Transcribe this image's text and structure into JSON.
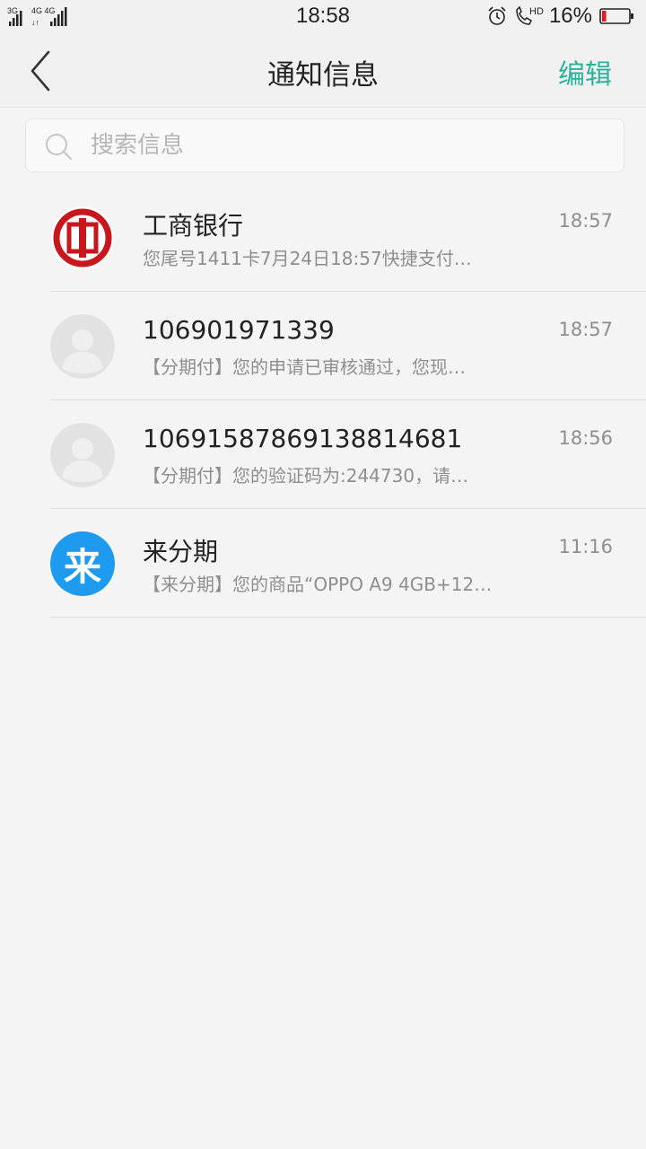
{
  "status_bar": {
    "network_left": "3G",
    "network_right": "4G 4G",
    "time": "18:58",
    "hd": "HD",
    "battery_percent": "16%",
    "battery_level": 0.16
  },
  "header": {
    "title": "通知信息",
    "edit_label": "编辑"
  },
  "search": {
    "placeholder": "搜索信息"
  },
  "colors": {
    "accent": "#2bb39a",
    "icbc_red": "#c8161d",
    "lai_blue": "#1e9bef",
    "battery_red": "#e02020"
  },
  "conversations": [
    {
      "name": "工商银行",
      "preview": "您尾号1411卡7月24日18:57快捷支付…",
      "time": "18:57",
      "avatar": "icbc-logo"
    },
    {
      "name": "106901971339",
      "preview": "【分期付】您的申请已审核通过，您现…",
      "time": "18:57",
      "avatar": "default-person-icon"
    },
    {
      "name": "10691587869138814681",
      "preview": "【分期付】您的验证码为:244730，请…",
      "time": "18:56",
      "avatar": "default-person-icon"
    },
    {
      "name": "来分期",
      "preview": "【来分期】您的商品“OPPO A9 4GB+12…",
      "time": "11:16",
      "avatar": "lai-logo",
      "avatar_text": "来"
    }
  ]
}
